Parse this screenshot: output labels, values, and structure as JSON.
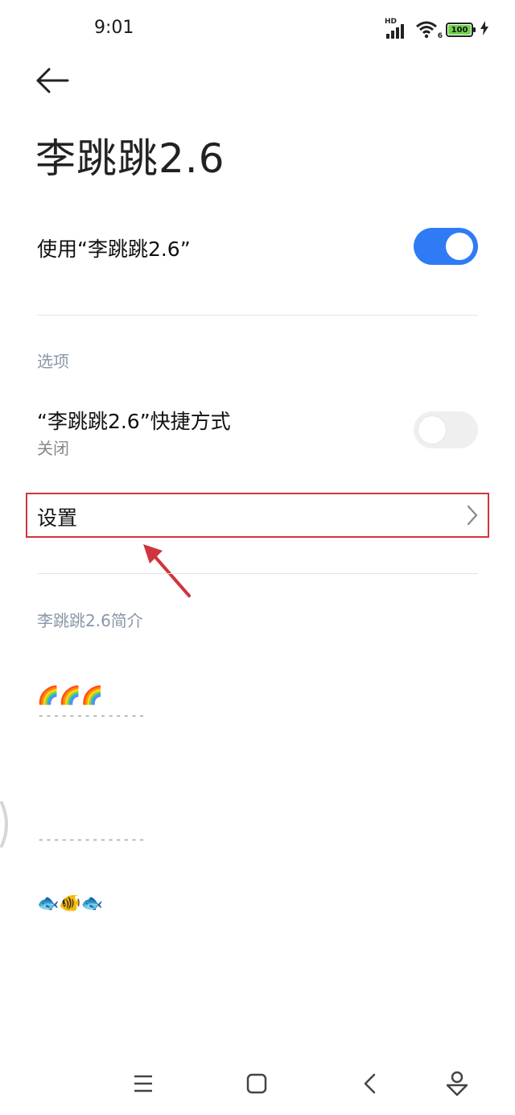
{
  "status_bar": {
    "time": "9:01",
    "network_label": "HD",
    "wifi_label": "6",
    "battery": "100",
    "battery_fill": 1.0,
    "battery_color": "#6fd44a"
  },
  "header": {
    "title": "李跳跳2.6"
  },
  "use_app": {
    "label": "使用“李跳跳2.6”",
    "enabled": true
  },
  "options": {
    "section_title": "选项",
    "shortcut": {
      "label": "“李跳跳2.6”快捷方式",
      "status": "关闭",
      "enabled": false
    },
    "settings": {
      "label": "设置"
    }
  },
  "intro": {
    "section_title": "李跳跳2.6简介",
    "emoji_top": "🌈🌈🌈",
    "divider_1": "--------------",
    "divider_2": "--------------",
    "emoji_bottom": "🐟🐠🐟"
  },
  "colors": {
    "accent": "#2f7bf5",
    "highlight_border": "#d0353f",
    "section_text": "#8a96a8"
  }
}
